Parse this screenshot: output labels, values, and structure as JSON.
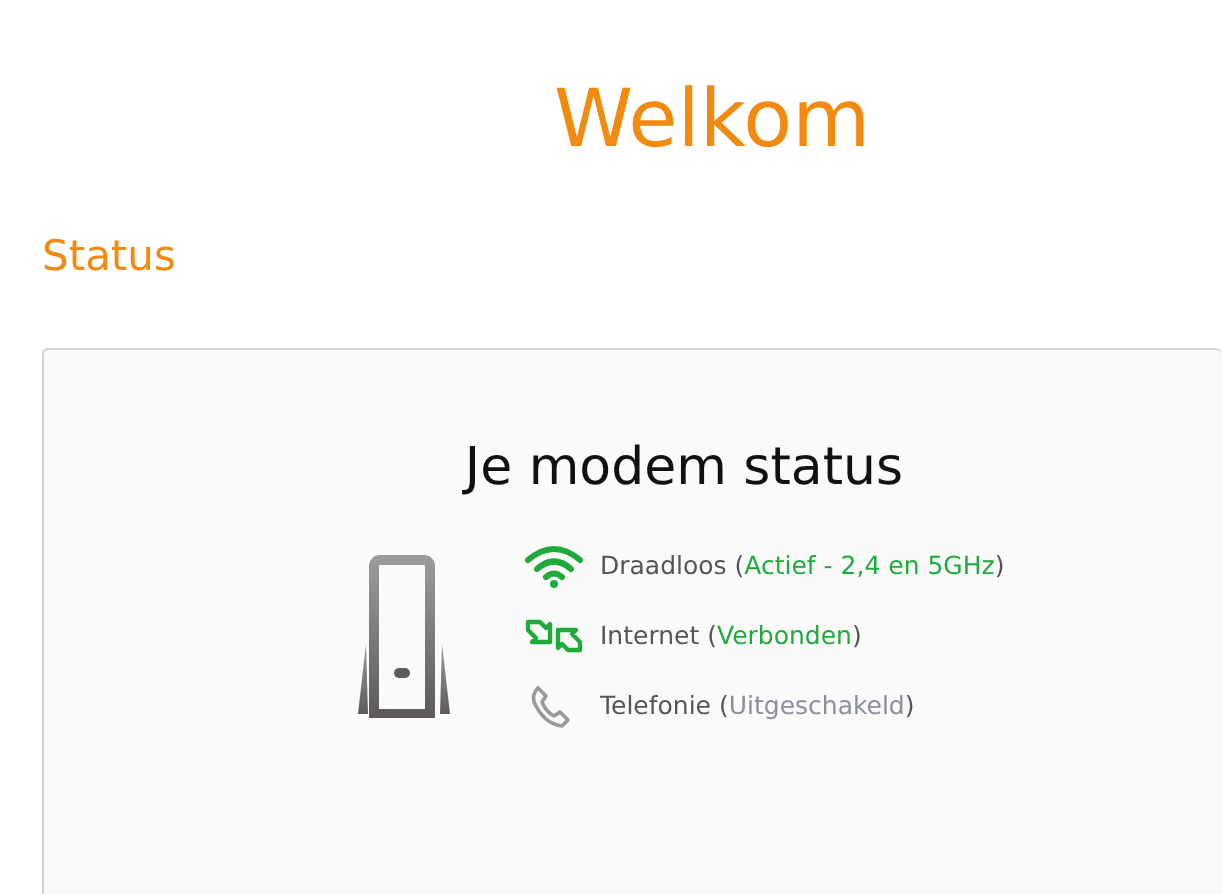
{
  "title": "Welkom",
  "section": "Status",
  "card": {
    "title": "Je modem status",
    "items": [
      {
        "kind": "wifi",
        "label": "Draadloos (",
        "state": "Actief - 2,4 en 5GHz",
        "close": ")",
        "active": true
      },
      {
        "kind": "internet",
        "label": "Internet (",
        "state": "Verbonden",
        "close": ")",
        "active": true
      },
      {
        "kind": "phone",
        "label": "Telefonie (",
        "state": "Uitgeschakeld",
        "close": ")",
        "active": false
      }
    ]
  }
}
